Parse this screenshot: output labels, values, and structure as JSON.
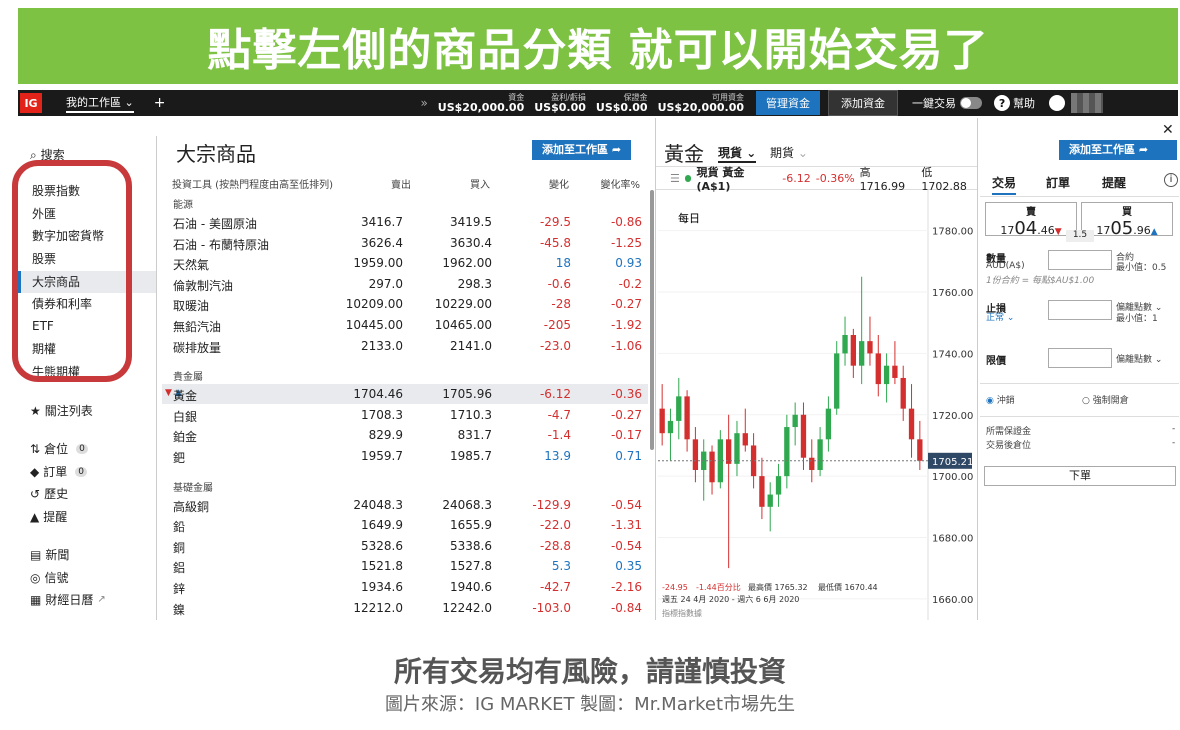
{
  "banner": "點擊左側的商品分類 就可以開始交易了",
  "topbar": {
    "logo": "IG",
    "workspace": "我的工作區",
    "plus": "+",
    "funds": [
      {
        "label": "資金",
        "value": "US$20,000.00"
      },
      {
        "label": "盈利/虧損",
        "value": "US$0.00"
      },
      {
        "label": "保證金",
        "value": "US$0.00"
      },
      {
        "label": "可用資金",
        "value": "US$20,000.00"
      }
    ],
    "manage_funds": "管理資金",
    "add_funds": "添加資金",
    "one_click": "一鍵交易",
    "help": "幫助"
  },
  "sidebar": {
    "search": "搜索",
    "categories": [
      "股票指數",
      "外匯",
      "數字加密貨幣",
      "股票",
      "大宗商品",
      "債券和利率",
      "ETF",
      "期權",
      "牛熊期權"
    ],
    "active_category": "大宗商品",
    "watchlist": "關注列表",
    "positions": "倉位",
    "positions_count": "0",
    "orders": "訂單",
    "orders_count": "0",
    "history": "歷史",
    "alerts": "提醒",
    "news": "新聞",
    "signals": "信號",
    "calendar": "財經日曆"
  },
  "table": {
    "title": "大宗商品",
    "add_btn": "添加至工作區",
    "headers": [
      "投資工具 (按熱門程度由高至低排列)",
      "賣出",
      "買入",
      "變化",
      "變化率%"
    ],
    "groups": [
      {
        "name": "能源",
        "rows": [
          [
            "石油 - 美國原油",
            "3416.7",
            "3419.5",
            "-29.5",
            "-0.86"
          ],
          [
            "石油 - 布蘭特原油",
            "3626.4",
            "3630.4",
            "-45.8",
            "-1.25"
          ],
          [
            "天然氣",
            "1959.00",
            "1962.00",
            "18",
            "0.93"
          ],
          [
            "倫敦制汽油",
            "297.0",
            "298.3",
            "-0.6",
            "-0.2"
          ],
          [
            "取暖油",
            "10209.00",
            "10229.00",
            "-28",
            "-0.27"
          ],
          [
            "無鉛汽油",
            "10445.00",
            "10465.00",
            "-205",
            "-1.92"
          ],
          [
            "碳排放量",
            "2133.0",
            "2141.0",
            "-23.0",
            "-1.06"
          ]
        ]
      },
      {
        "name": "貴金屬",
        "rows": [
          [
            "黃金",
            "1704.46",
            "1705.96",
            "-6.12",
            "-0.36"
          ],
          [
            "白銀",
            "1708.3",
            "1710.3",
            "-4.7",
            "-0.27"
          ],
          [
            "鉑金",
            "829.9",
            "831.7",
            "-1.4",
            "-0.17"
          ],
          [
            "鈀",
            "1959.7",
            "1985.7",
            "13.9",
            "0.71"
          ]
        ]
      },
      {
        "name": "基礎金屬",
        "rows": [
          [
            "高級銅",
            "24048.3",
            "24068.3",
            "-129.9",
            "-0.54"
          ],
          [
            "鉛",
            "1649.9",
            "1655.9",
            "-22.0",
            "-1.31"
          ],
          [
            "銅",
            "5328.6",
            "5338.6",
            "-28.8",
            "-0.54"
          ],
          [
            "鋁",
            "1521.8",
            "1527.8",
            "5.3",
            "0.35"
          ],
          [
            "鋅",
            "1934.6",
            "1940.6",
            "-42.7",
            "-2.16"
          ],
          [
            "鎳",
            "12212.0",
            "12242.0",
            "-103.0",
            "-0.84"
          ]
        ]
      }
    ]
  },
  "chart": {
    "title": "黃金",
    "tab_spot": "現貨",
    "tab_futures": "期貨",
    "add_btn": "添加至工作區",
    "header_name": "現貨 黃金 (A$1)",
    "header_change": "-6.12",
    "header_pct": "-0.36%",
    "header_high": "高 1716.99",
    "header_low": "低 1702.88",
    "period": "每日",
    "y_ticks": [
      "1780.00",
      "1760.00",
      "1740.00",
      "1720.00",
      "1700.00",
      "1680.00",
      "1660.00"
    ],
    "current_price": "1705.21",
    "footer_change": "-24.95",
    "footer_pct": "-1.44百分比",
    "footer_high": "最高價 1765.32",
    "footer_low": "最低價 1670.44",
    "footer_range": "週五 24 4月 2020 - 週六 6 6月 2020",
    "footer_note": "指標指數據"
  },
  "chart_data": {
    "type": "candlestick",
    "ylim": [
      1658,
      1790
    ],
    "y_ticks": [
      1780,
      1760,
      1740,
      1720,
      1700,
      1680,
      1660
    ],
    "candles": [
      [
        1722,
        1730,
        1710,
        1714
      ],
      [
        1714,
        1722,
        1705,
        1718
      ],
      [
        1718,
        1732,
        1712,
        1726
      ],
      [
        1726,
        1728,
        1708,
        1712
      ],
      [
        1712,
        1716,
        1698,
        1702
      ],
      [
        1702,
        1712,
        1692,
        1708
      ],
      [
        1708,
        1710,
        1694,
        1698
      ],
      [
        1698,
        1715,
        1696,
        1712
      ],
      [
        1712,
        1720,
        1670,
        1704
      ],
      [
        1704,
        1718,
        1700,
        1714
      ],
      [
        1714,
        1722,
        1708,
        1710
      ],
      [
        1710,
        1714,
        1696,
        1700
      ],
      [
        1700,
        1706,
        1686,
        1690
      ],
      [
        1690,
        1698,
        1682,
        1694
      ],
      [
        1694,
        1704,
        1690,
        1700
      ],
      [
        1700,
        1720,
        1696,
        1716
      ],
      [
        1716,
        1724,
        1710,
        1720
      ],
      [
        1720,
        1724,
        1702,
        1706
      ],
      [
        1706,
        1712,
        1698,
        1702
      ],
      [
        1702,
        1716,
        1700,
        1712
      ],
      [
        1712,
        1726,
        1708,
        1722
      ],
      [
        1722,
        1744,
        1720,
        1740
      ],
      [
        1740,
        1752,
        1736,
        1746
      ],
      [
        1746,
        1748,
        1732,
        1736
      ],
      [
        1736,
        1765,
        1730,
        1744
      ],
      [
        1744,
        1752,
        1736,
        1740
      ],
      [
        1740,
        1746,
        1726,
        1730
      ],
      [
        1730,
        1740,
        1724,
        1736
      ],
      [
        1736,
        1744,
        1730,
        1732
      ],
      [
        1732,
        1736,
        1718,
        1722
      ],
      [
        1722,
        1730,
        1706,
        1712
      ],
      [
        1712,
        1718,
        1702,
        1705
      ]
    ]
  },
  "trade": {
    "tabs": [
      "交易",
      "訂單",
      "提醒"
    ],
    "sell_label": "賣",
    "sell_big": "04",
    "sell_prefix": "17",
    "sell_suffix": ".46",
    "buy_label": "買",
    "buy_big": "05",
    "buy_prefix": "17",
    "buy_suffix": ".96",
    "spread": "1.5",
    "qty_label": "數量",
    "qty_unit": "AUD(A$)",
    "contract": "合約",
    "min_qty": "最小值：0.5",
    "contract_note": "1份合約 = 每點$AU$1.00",
    "stop_label": "止損",
    "stop_type": "正常",
    "stop_pts": "偏離點數",
    "stop_min": "最小值：1",
    "limit_label": "限價",
    "limit_pts": "偏離點數",
    "close_opt": "沖銷",
    "force_opt": "強制開倉",
    "margin_req": "所需保證金",
    "margin_val": "-",
    "pos_after": "交易後倉位",
    "pos_val": "-",
    "order_btn": "下單"
  },
  "footer": {
    "warning": "所有交易均有風險，請謹慎投資",
    "source": "圖片來源：IG MARKET 製圖：Mr.Market市場先生"
  },
  "colors": {
    "banner": "#7dc242",
    "brand_red": "#e2231a",
    "blue": "#1e73be",
    "up": "#2fa84f",
    "down": "#d42f2f",
    "highlight": "#c8393b"
  }
}
